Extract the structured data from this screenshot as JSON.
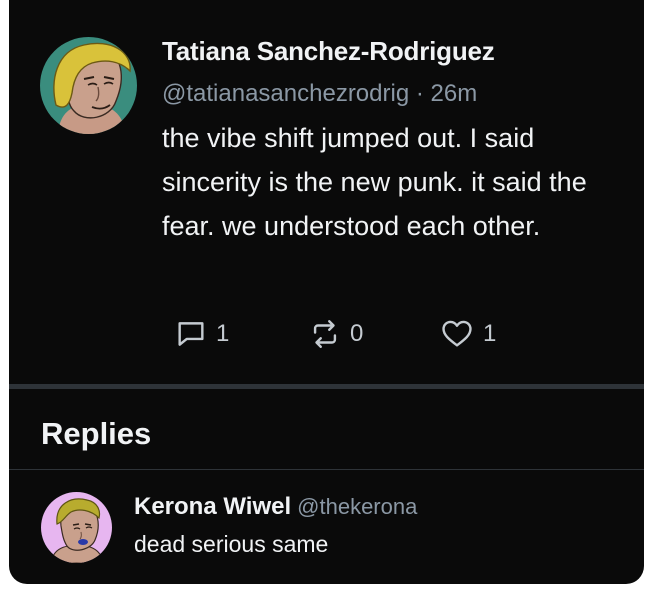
{
  "post": {
    "author_name": "Tatiana Sanchez-Rodriguez",
    "handle": "@tatianasanchezrodrig",
    "separator": " · ",
    "time_ago": "26m",
    "text": "the vibe shift jumped out. I said sincerity is the new punk. it said the fear. we understood each other.",
    "avatar_bg": "#3a8d7e",
    "actions": {
      "reply_icon": "speech-bubble-icon",
      "reply_count": "1",
      "repost_icon": "repost-arrows-icon",
      "repost_count": "0",
      "like_icon": "heart-icon",
      "like_count": "1"
    }
  },
  "replies": {
    "heading": "Replies",
    "items": [
      {
        "author_name": "Kerona Wiwel",
        "handle": "@thekerona",
        "text": "dead serious same",
        "avatar_bg": "#e7b6f0"
      }
    ]
  },
  "colors": {
    "background": "#0a0a0a",
    "text_primary": "#f1f3f5",
    "text_secondary": "#8b98a5",
    "divider": "#2e3338"
  }
}
